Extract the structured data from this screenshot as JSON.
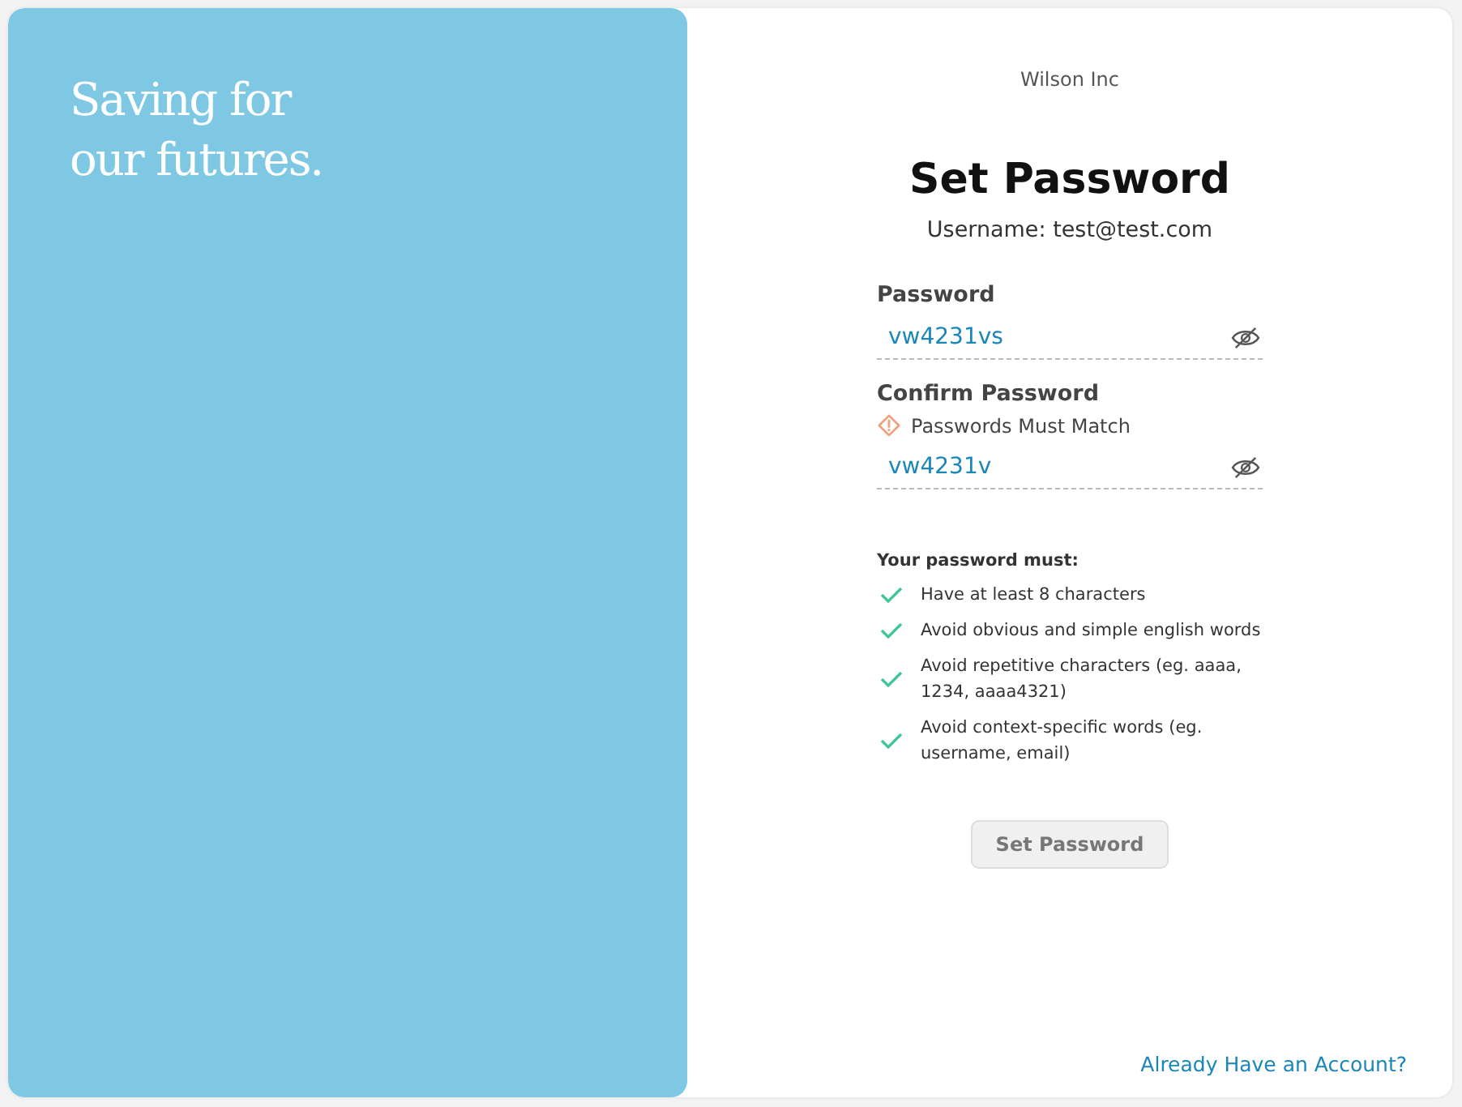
{
  "tagline": "Saving for our futures.",
  "company": "Wilson Inc",
  "title": "Set Password",
  "username": "Username: test@test.com",
  "fields": [
    {
      "label": "Password",
      "value": "vw4231vs"
    },
    {
      "label": "Confirm Password",
      "error": "Passwords Must Match",
      "value": "vw4231v"
    }
  ],
  "rules_title": "Your password must:",
  "rules": [
    {
      "text": "Have at least 8 characters",
      "checked": true
    },
    {
      "text": "Avoid obvious and simple english words",
      "checked": true
    },
    {
      "text": "Avoid repetitive characters (eg. aaaa, 1234, aaaa4321)",
      "checked": true
    },
    {
      "text": "Avoid context-specific words (eg. username, email)",
      "checked": true
    }
  ],
  "submit": {
    "label": "Set Password",
    "disabled": true
  },
  "login_link": "Already Have an Account?"
}
